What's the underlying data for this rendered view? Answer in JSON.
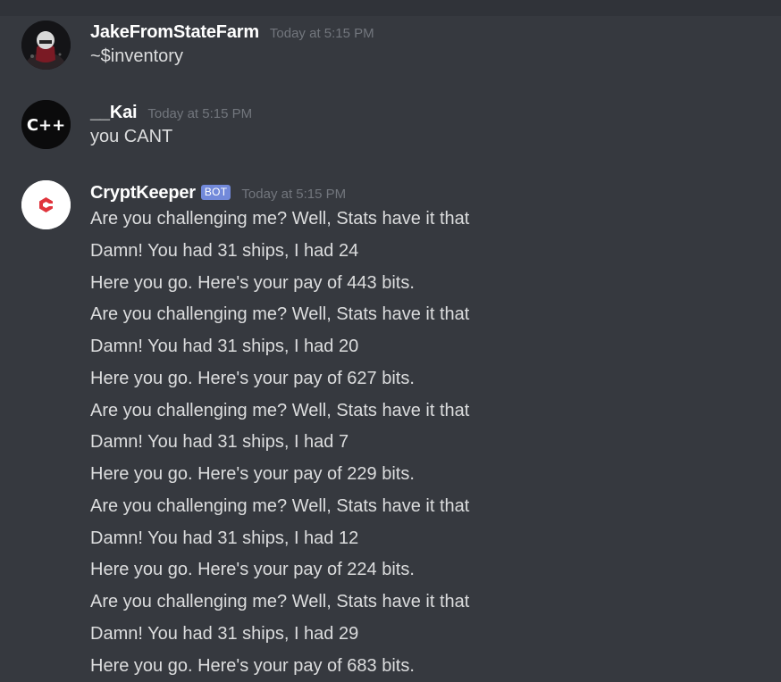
{
  "colors": {
    "background": "#36393f",
    "username": "#ffffff",
    "message_text": "#dcddde",
    "timestamp": "#72767d",
    "bot_tag_bg": "#7289da"
  },
  "messages": [
    {
      "username": "JakeFromStateFarm",
      "timestamp": "Today at 5:15 PM",
      "avatar_icon": "character-avatar-icon",
      "lines": [
        "~$inventory"
      ]
    },
    {
      "username": "__Kai",
      "timestamp": "Today at 5:15 PM",
      "avatar_icon": "cpp-logo-avatar-icon",
      "avatar_text": "C++",
      "lines": [
        "you CANT"
      ]
    },
    {
      "username": "CryptKeeper",
      "bot_tag": "BOT",
      "timestamp": "Today at 5:15 PM",
      "avatar_icon": "cryptkeeper-logo-icon",
      "lines": [
        "Are you challenging me? Well, Stats have it that",
        "Damn! You had 31 ships, I had 24",
        "Here you go. Here's your pay of 443 bits.",
        "Are you challenging me? Well, Stats have it that",
        "Damn! You had 31 ships, I had 20",
        "Here you go. Here's your pay of 627 bits.",
        "Are you challenging me? Well, Stats have it that",
        "Damn! You had 31 ships, I had 7",
        "Here you go. Here's your pay of 229 bits.",
        "Are you challenging me? Well, Stats have it that",
        "Damn! You had 31 ships, I had 12",
        "Here you go. Here's your pay of 224 bits.",
        "Are you challenging me? Well, Stats have it that",
        "Damn! You had 31 ships, I had 29",
        "Here you go. Here's your pay of 683 bits."
      ]
    }
  ]
}
